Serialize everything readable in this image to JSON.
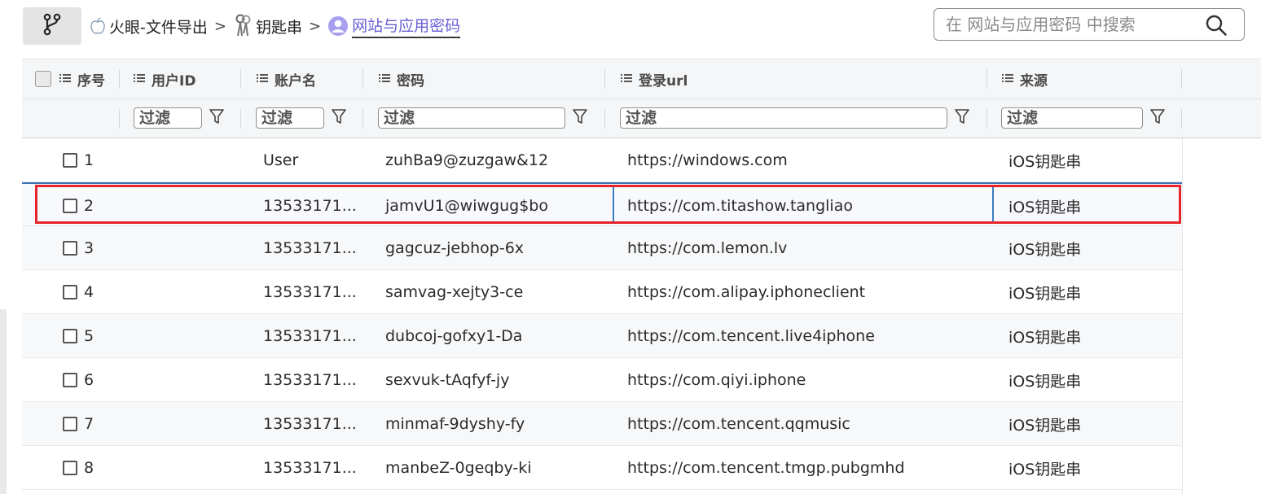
{
  "breadcrumb": {
    "items": [
      {
        "label": "火眼-文件导出",
        "icon": "apple-icon"
      },
      {
        "label": "钥匙串",
        "icon": "keys-icon"
      },
      {
        "label": "网站与应用密码",
        "icon": "user-avatar-icon"
      }
    ],
    "separator": ">"
  },
  "search": {
    "placeholder": "在 网站与应用密码 中搜索"
  },
  "table": {
    "columns": [
      {
        "label": "序号"
      },
      {
        "label": "用户ID"
      },
      {
        "label": "账户名"
      },
      {
        "label": "密码"
      },
      {
        "label": "登录url"
      },
      {
        "label": "来源"
      }
    ],
    "filter_placeholder": "过滤",
    "rows": [
      {
        "index": "1",
        "user_id": "",
        "account": "User",
        "password": "zuhBa9@zuzgaw&12",
        "url": "https://windows.com",
        "source": "iOS钥匙串"
      },
      {
        "index": "2",
        "user_id": "",
        "account": "13533171...",
        "password": "jamvU1@wiwgug$bo",
        "url": "https://com.titashow.tangliao",
        "source": "iOS钥匙串"
      },
      {
        "index": "3",
        "user_id": "",
        "account": "13533171...",
        "password": "gagcuz-jebhop-6x",
        "url": "https://com.lemon.lv",
        "source": "iOS钥匙串"
      },
      {
        "index": "4",
        "user_id": "",
        "account": "13533171...",
        "password": "samvag-xejty3-ce",
        "url": "https://com.alipay.iphoneclient",
        "source": "iOS钥匙串"
      },
      {
        "index": "5",
        "user_id": "",
        "account": "13533171...",
        "password": "dubcoj-gofxy1-Da",
        "url": "https://com.tencent.live4iphone",
        "source": "iOS钥匙串"
      },
      {
        "index": "6",
        "user_id": "",
        "account": "13533171...",
        "password": "sexvuk-tAqfyf-jy",
        "url": "https://com.qiyi.iphone",
        "source": "iOS钥匙串"
      },
      {
        "index": "7",
        "user_id": "",
        "account": "13533171...",
        "password": "minmaf-9dyshy-fy",
        "url": "https://com.tencent.qqmusic",
        "source": "iOS钥匙串"
      },
      {
        "index": "8",
        "user_id": "",
        "account": "13533171...",
        "password": "manbeZ-0geqby-ki",
        "url": "https://com.tencent.tmgp.pubgmhd",
        "source": "iOS钥匙串"
      }
    ]
  },
  "colors": {
    "accent": "#6b5fd6",
    "highlight_border": "#e5252b",
    "selection": "#3b7fc4"
  }
}
